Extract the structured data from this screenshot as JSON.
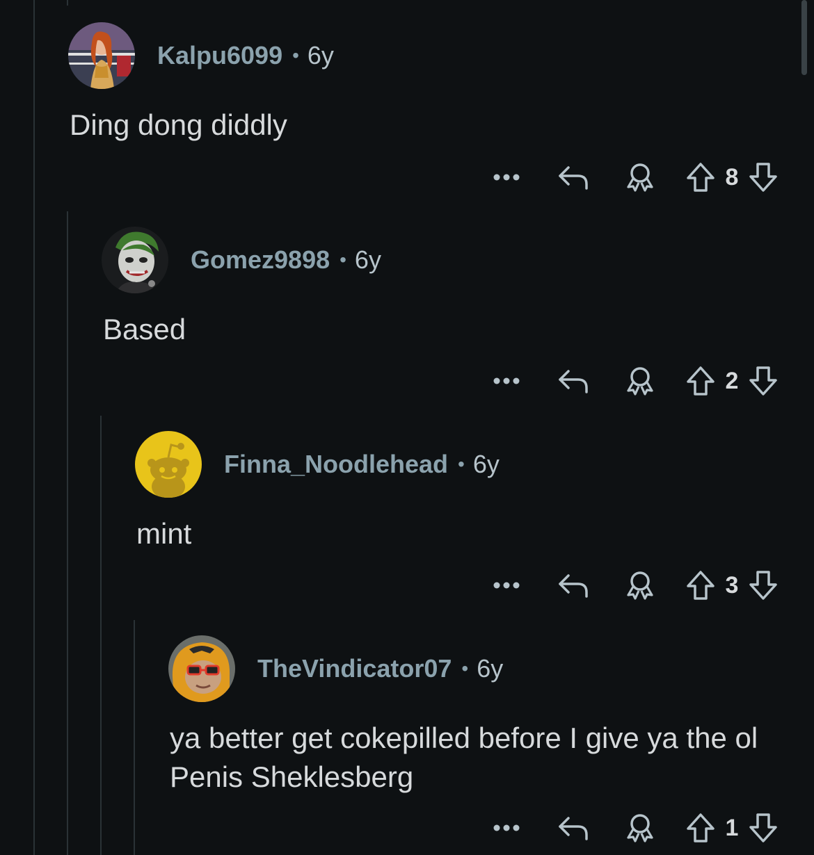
{
  "comments": [
    {
      "author": "Kalpu6099",
      "separator": "•",
      "age": "6y",
      "text": "Ding dong diddly",
      "score": "8",
      "avatar_icon": "wrestler-avatar"
    },
    {
      "author": "Gomez9898",
      "separator": "•",
      "age": "6y",
      "text": "Based",
      "score": "2",
      "avatar_icon": "joker-avatar"
    },
    {
      "author": "Finna_Noodlehead",
      "separator": "•",
      "age": "6y",
      "text": "mint",
      "score": "3",
      "avatar_icon": "snoo-default-avatar"
    },
    {
      "author": "TheVindicator07",
      "separator": "•",
      "age": "6y",
      "text": "ya better get cokepilled before I give ya the ol Penis Sheklesberg",
      "score": "1",
      "avatar_icon": "orange-hood-sunglasses-avatar"
    }
  ],
  "colors": {
    "background": "#0e1113",
    "author": "#8ba2ad",
    "body_text": "#d7dadc",
    "icon": "#b7c4cb",
    "thread_line": "#2a3236",
    "snoo_yellow": "#e8c41a"
  }
}
